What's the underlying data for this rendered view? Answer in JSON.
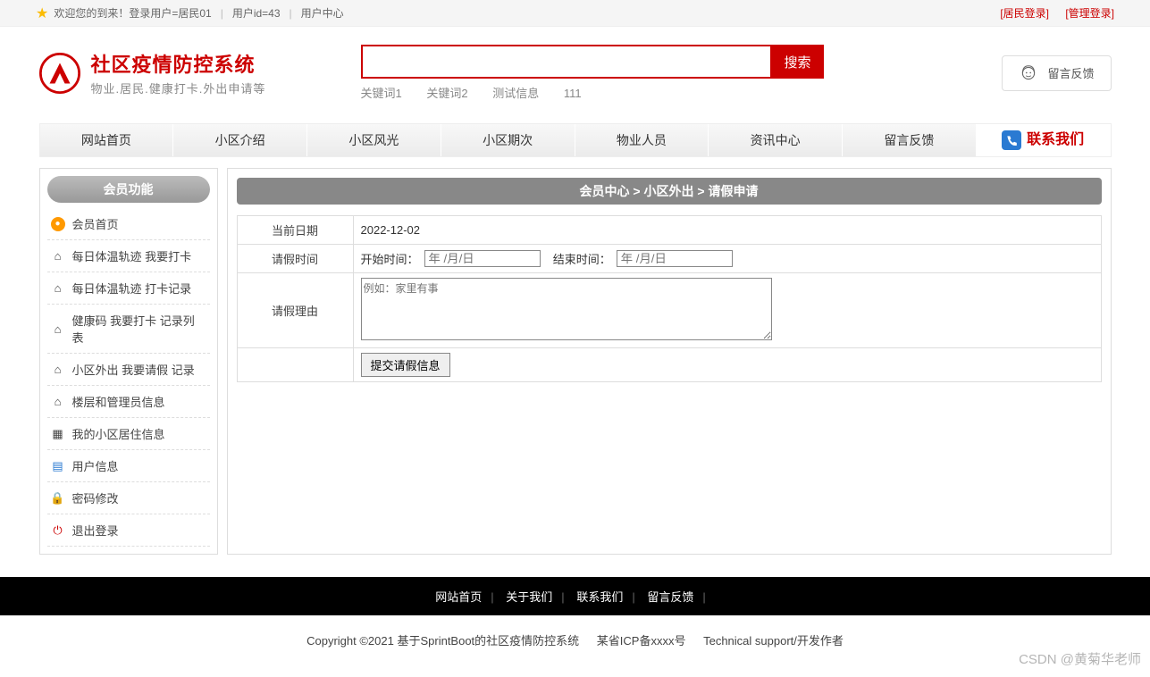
{
  "topbar": {
    "welcome": "欢迎您的到来！登录用户=居民01",
    "user_id": "用户id=43",
    "user_center": "用户中心",
    "resident_login": "[居民登录]",
    "admin_login": "[管理登录]"
  },
  "brand": {
    "title": "社区疫情防控系统",
    "subtitle": "物业.居民.健康打卡.外出申请等"
  },
  "search": {
    "button": "搜索",
    "keywords": [
      "关键词1",
      "关键词2",
      "测试信息",
      "111"
    ]
  },
  "feedback_button": "留言反馈",
  "nav": {
    "items": [
      "网站首页",
      "小区介绍",
      "小区风光",
      "小区期次",
      "物业人员",
      "资讯中心",
      "留言反馈"
    ],
    "contact": "联系我们"
  },
  "sidebar": {
    "title": "会员功能",
    "items": [
      {
        "icon": "home-dot",
        "label": "会员首页",
        "color": "orange"
      },
      {
        "icon": "home",
        "label": "每日体温轨迹 我要打卡"
      },
      {
        "icon": "home",
        "label": "每日体温轨迹 打卡记录"
      },
      {
        "icon": "home",
        "label": "健康码 我要打卡 记录列表"
      },
      {
        "icon": "home",
        "label": "小区外出 我要请假 记录"
      },
      {
        "icon": "home",
        "label": "楼层和管理员信息"
      },
      {
        "icon": "grid",
        "label": "我的小区居住信息"
      },
      {
        "icon": "doc",
        "label": "用户信息",
        "color": "blue"
      },
      {
        "icon": "lock",
        "label": "密码修改",
        "color": "orange"
      },
      {
        "icon": "power",
        "label": "退出登录",
        "color": "red"
      }
    ]
  },
  "breadcrumb": "会员中心 > 小区外出 > 请假申请",
  "form": {
    "row_date_label": "当前日期",
    "row_date_value": "2022-12-02",
    "row_time_label": "请假时间",
    "start_label": "开始时间：",
    "end_label": "结束时间：",
    "date_placeholder": "年 /月/日",
    "row_reason_label": "请假理由",
    "reason_placeholder": "例如：家里有事",
    "submit": "提交请假信息"
  },
  "footer": {
    "links": [
      "网站首页",
      "关于我们",
      "联系我们",
      "留言反馈"
    ],
    "copyright": "Copyright ©2021 基于SprintBoot的社区疫情防控系统",
    "icp": "某省ICP备xxxx号",
    "tech": "Technical support/开发作者"
  },
  "watermark": "CSDN @黄菊华老师"
}
